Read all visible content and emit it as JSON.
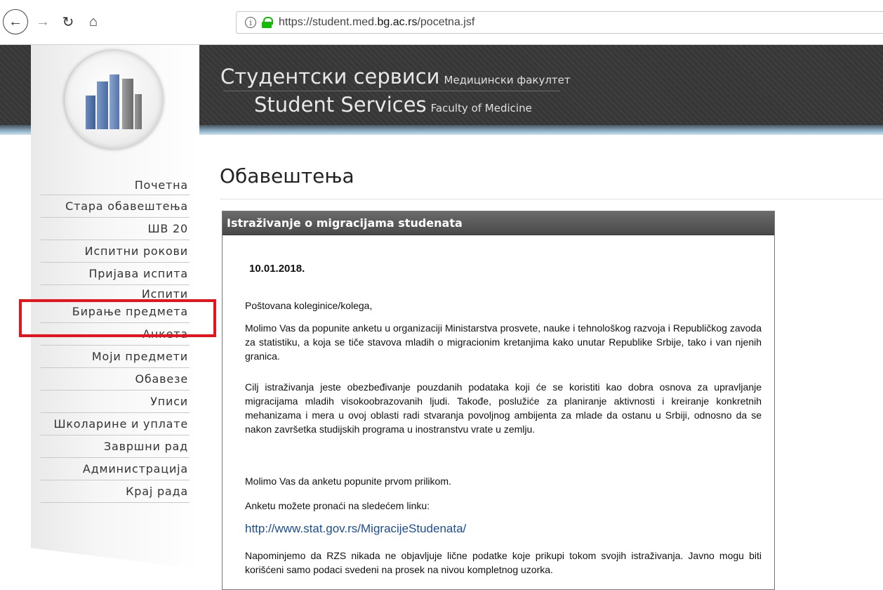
{
  "browser": {
    "url_prefix": "https://student.med.",
    "url_host": "bg.ac.rs",
    "url_suffix": "/pocetna.jsf"
  },
  "header": {
    "title_sr": "Студентски сервиси",
    "subtitle_sr": "Медицински факултет",
    "title_en": "Student Services",
    "subtitle_en": "Faculty of Medicine"
  },
  "sidebar": {
    "items": [
      {
        "label": "Почетна"
      },
      {
        "label": "Стара обавештења"
      },
      {
        "label": "ШВ 20"
      },
      {
        "label": "Испитни рокови"
      },
      {
        "label": "Пријава испита"
      },
      {
        "label": "Испити"
      },
      {
        "label": "Бирање предмета"
      },
      {
        "label": "Анкета"
      },
      {
        "label": "Моји предмети"
      },
      {
        "label": "Обавезе"
      },
      {
        "label": "Уписи"
      },
      {
        "label": "Школарине и уплате"
      },
      {
        "label": "Завршни рад"
      },
      {
        "label": "Администрација"
      },
      {
        "label": "Крај рада"
      }
    ]
  },
  "main": {
    "heading": "Обавештења",
    "notice": {
      "title": "Istraživanje o migracijama studenata",
      "date": "10.01.2018.",
      "greeting": "Poštovana koleginice/kolega,",
      "paragraph1": "Molimo Vas da popunite anketu u organizaciji Ministarstva prosvete, nauke i tehnološkog razvoja i Republičkog zavoda za statistiku, a koja se tiče stavova mladih o migracionim kretanjima kako unutar Republike Srbije, tako i van njenih granica.",
      "paragraph2": "Cilj istraživanja jeste obezbeđivanje pouzdanih podataka koji će se koristiti kao dobra osnova za upravljanje migracijama mladih visokoobrazovanih ljudi. Takođe, poslužiće za planiranje aktivnosti i kreiranje konkretnih mehanizama i mera u ovoj oblasti radi stvaranja povoljnog ambijenta za mlade da ostanu u Srbiji, odnosno da se nakon završetka studijskih programa u inostranstvu vrate u zemlju.",
      "paragraph3": "Molimo Vas da anketu popunite prvom prilikom.",
      "paragraph4": "Anketu možete pronaći na sledećem linku:",
      "link": "http://www.stat.gov.rs/MigracijeStudenata/",
      "paragraph5": "Napominjemo da RZS nikada ne objavljuje lične podatke koje prikupi tokom svojih istraživanja. Javno mogu biti korišćeni samo podaci svedeni na prosek na nivou kompletnog uzorka."
    }
  },
  "annotation": {
    "highlight_color": "#e8141b"
  }
}
